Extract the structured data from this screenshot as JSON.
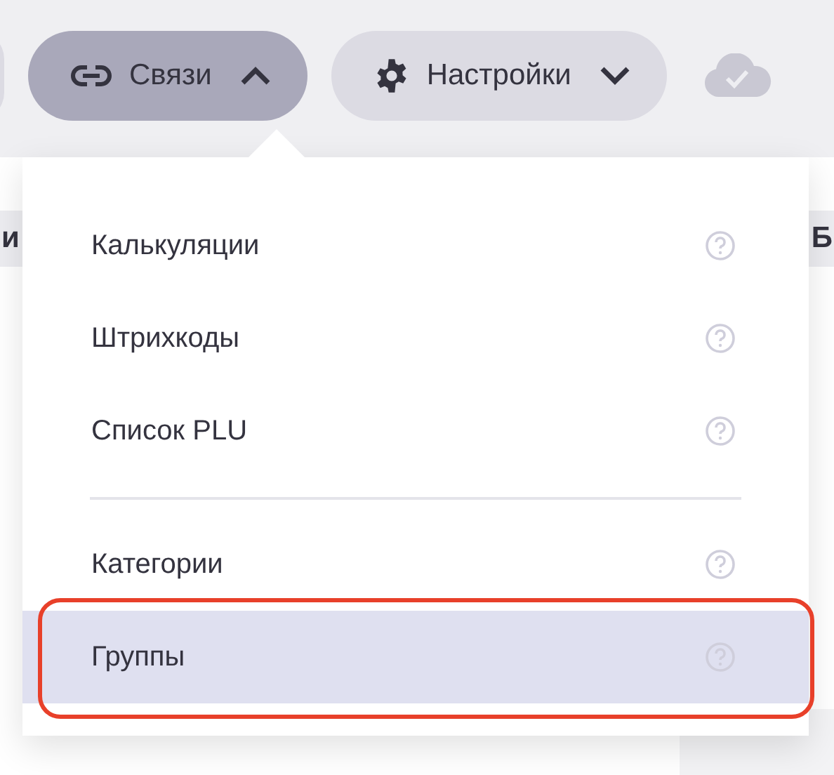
{
  "toolbar": {
    "buttons": [
      {
        "label": "Связи",
        "expanded": true
      },
      {
        "label": "Настройки",
        "expanded": false
      }
    ]
  },
  "table_header": {
    "column_1": "и",
    "column_2": "Б"
  },
  "menu": {
    "groups": [
      [
        {
          "label": "Калькуляции",
          "selected": false,
          "outlined": false
        },
        {
          "label": "Штрихкоды",
          "selected": false,
          "outlined": false
        },
        {
          "label": "Список PLU",
          "selected": false,
          "outlined": false
        }
      ],
      [
        {
          "label": "Категории",
          "selected": false,
          "outlined": false
        },
        {
          "label": "Группы",
          "selected": true,
          "outlined": true
        }
      ]
    ]
  }
}
